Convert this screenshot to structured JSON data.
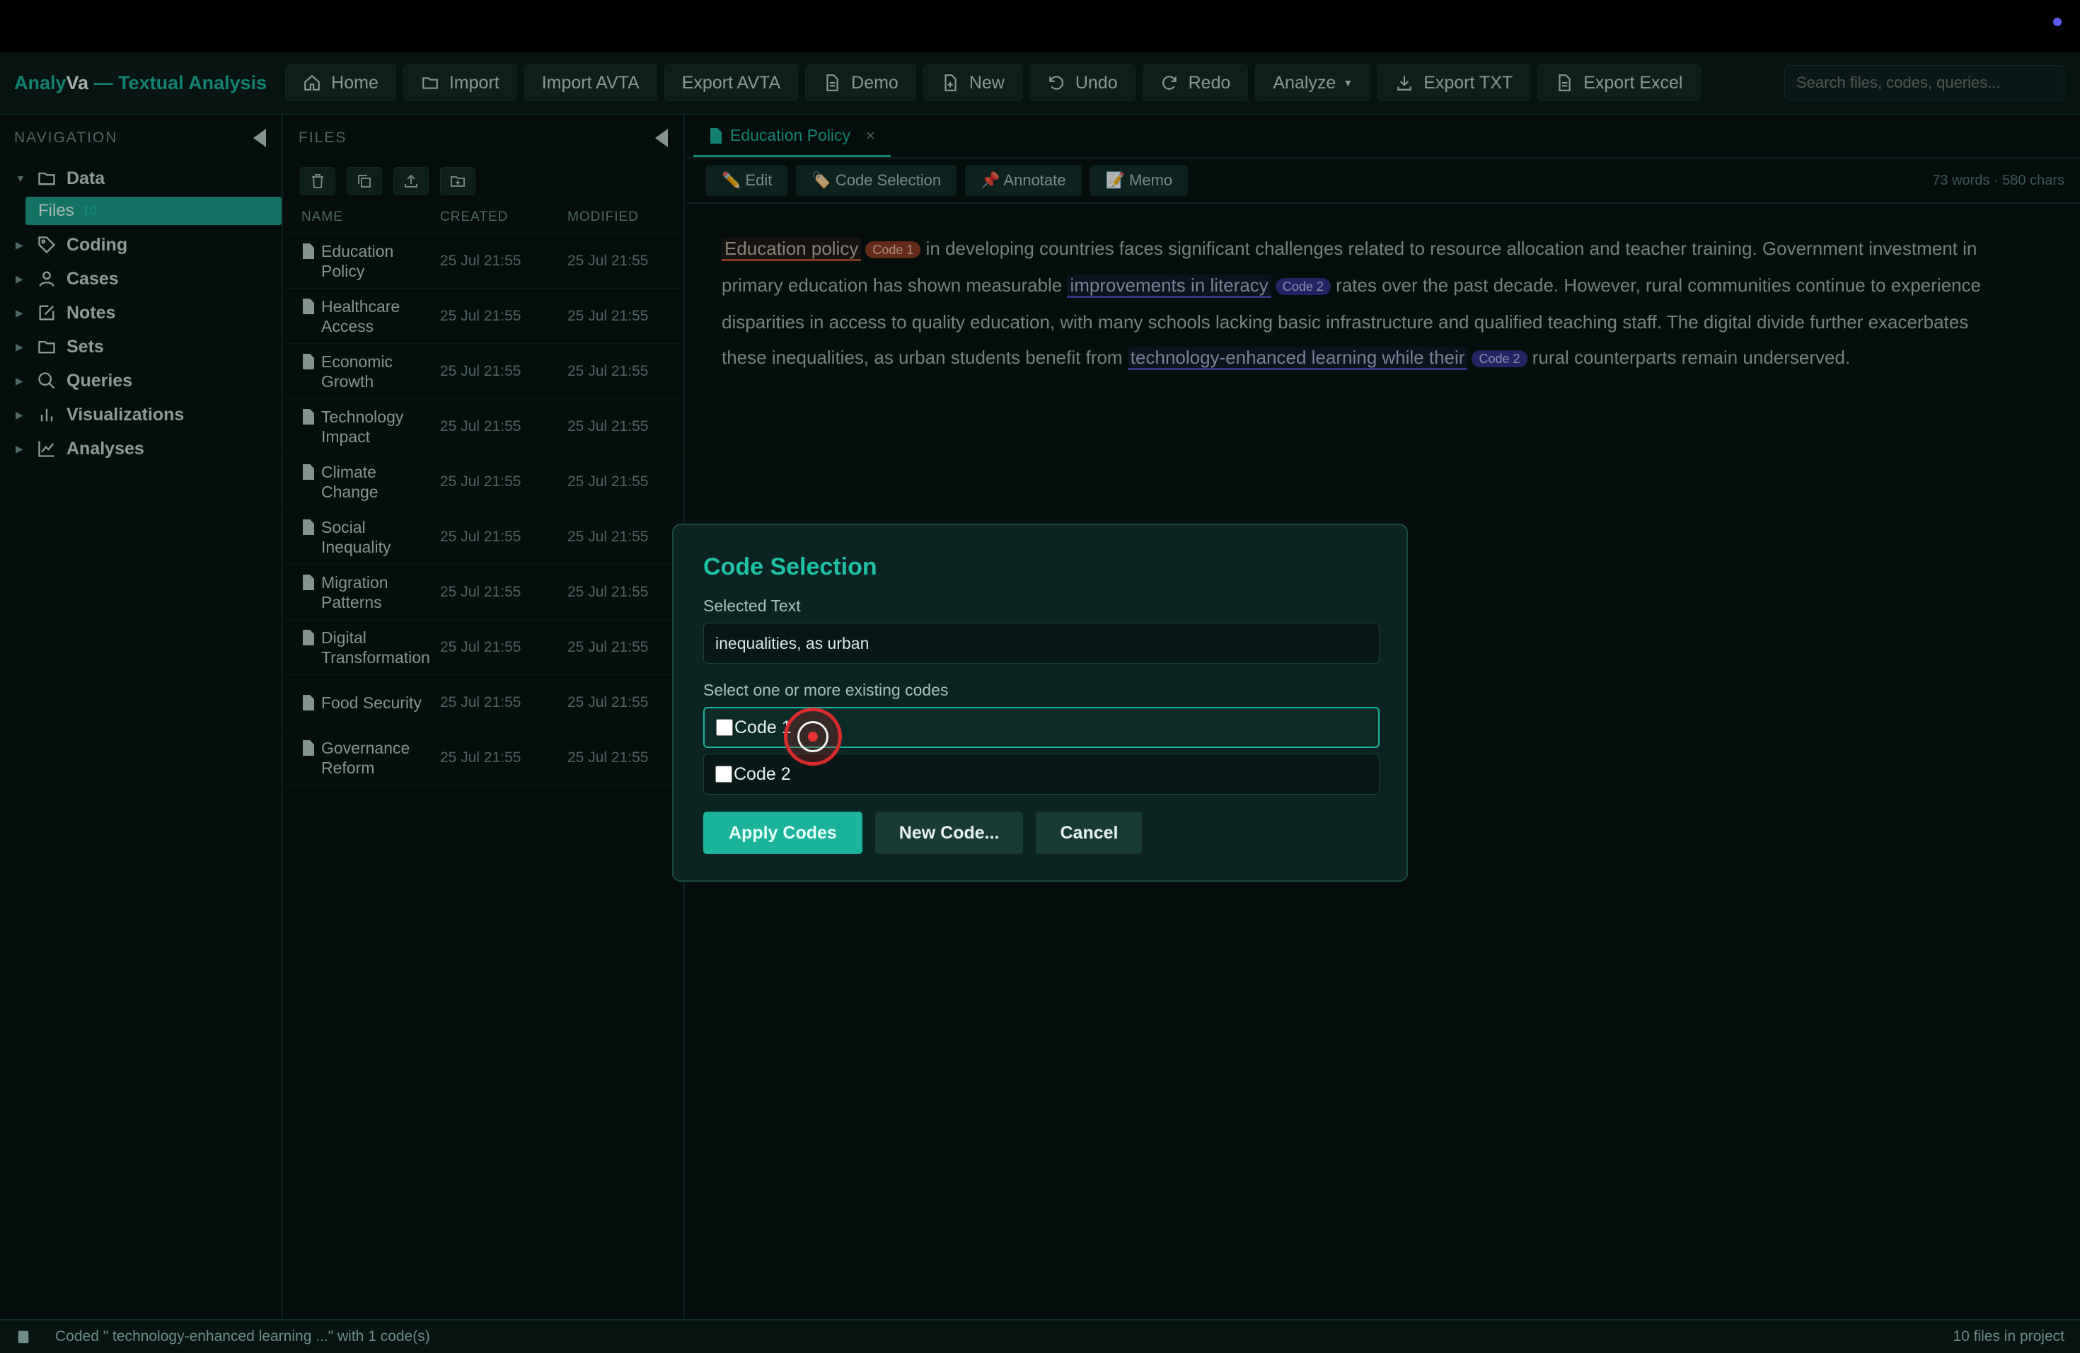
{
  "app": {
    "brand_prefix": "Analy",
    "brand_bold": "Va",
    "brand_suffix": " — Textual Analysis"
  },
  "toolbar": {
    "buttons": [
      {
        "label": "Home",
        "icon": "home-icon"
      },
      {
        "label": "Import",
        "icon": "folder-icon"
      },
      {
        "label": "Import AVTA",
        "icon": ""
      },
      {
        "label": "Export AVTA",
        "icon": ""
      },
      {
        "label": "Demo",
        "icon": "document-icon"
      },
      {
        "label": "New",
        "icon": "new-file-icon"
      },
      {
        "label": "Undo",
        "icon": "undo-icon"
      },
      {
        "label": "Redo",
        "icon": "redo-icon"
      },
      {
        "label": "Analyze",
        "icon": ""
      },
      {
        "label": "Export TXT",
        "icon": "download-icon"
      },
      {
        "label": "Export Excel",
        "icon": "document-icon"
      }
    ],
    "search_placeholder": "Search files, codes, queries..."
  },
  "nav": {
    "header": "NAVIGATION",
    "items": [
      {
        "label": "Data",
        "icon": "folder-icon",
        "expanded": true
      },
      {
        "label": "Coding",
        "icon": "tag-icon"
      },
      {
        "label": "Cases",
        "icon": "user-icon"
      },
      {
        "label": "Notes",
        "icon": "note-edit-icon"
      },
      {
        "label": "Sets",
        "icon": "folder-icon"
      },
      {
        "label": "Queries",
        "icon": "search-icon"
      },
      {
        "label": "Visualizations",
        "icon": "bar-chart-icon"
      },
      {
        "label": "Analyses",
        "icon": "line-chart-icon"
      }
    ],
    "data_sub": {
      "label": "Files",
      "count": "10"
    }
  },
  "files": {
    "header": "FILES",
    "columns": [
      "NAME",
      "CREATED",
      "MODIFIED"
    ],
    "rows": [
      {
        "name": "Education Policy",
        "created": "25 Jul 21:55",
        "modified": "25 Jul 21:55"
      },
      {
        "name": "Healthcare Access",
        "created": "25 Jul 21:55",
        "modified": "25 Jul 21:55"
      },
      {
        "name": "Economic Growth",
        "created": "25 Jul 21:55",
        "modified": "25 Jul 21:55"
      },
      {
        "name": "Technology Impact",
        "created": "25 Jul 21:55",
        "modified": "25 Jul 21:55"
      },
      {
        "name": "Climate Change",
        "created": "25 Jul 21:55",
        "modified": "25 Jul 21:55"
      },
      {
        "name": "Social Inequality",
        "created": "25 Jul 21:55",
        "modified": "25 Jul 21:55"
      },
      {
        "name": "Migration Patterns",
        "created": "25 Jul 21:55",
        "modified": "25 Jul 21:55"
      },
      {
        "name": "Digital Transformation",
        "created": "25 Jul 21:55",
        "modified": "25 Jul 21:55"
      },
      {
        "name": "Food Security",
        "created": "25 Jul 21:55",
        "modified": "25 Jul 21:55"
      },
      {
        "name": "Governance Reform",
        "created": "25 Jul 21:55",
        "modified": "25 Jul 21:55"
      }
    ]
  },
  "doc": {
    "tab_label": "Education Policy",
    "tools": [
      "✏️ Edit",
      "🏷️ Code Selection",
      "📌 Annotate",
      "📝 Memo"
    ],
    "stats": "73 words · 580 chars",
    "text": {
      "hl1": "Education policy",
      "badge1": "Code 1",
      "seg1": " in developing countries faces significant challenges related to resource allocation and teacher training. Government investment in primary education has shown measurable ",
      "hl2": "improvements in literacy",
      "badge2": "Code 2",
      "seg2": " rates over the past decade. However, rural communities continue to experience disparities in access to quality education, with many schools lacking basic infrastructure and qualified teaching staff. The digital divide further exacerbates these inequalities, as urban students benefit from ",
      "hl3": " technology-enhanced learning while their",
      "badge3": "Code 2",
      "seg3": " rural counterparts remain underserved."
    }
  },
  "modal": {
    "title": "Code Selection",
    "selected_label": "Selected Text",
    "selected_value": "inequalities, as urban",
    "codes_label": "Select one or more existing codes",
    "codes": [
      "Code 1",
      "Code 2"
    ],
    "apply": "Apply Codes",
    "new_code": "New Code...",
    "cancel": "Cancel"
  },
  "status": {
    "message": "Coded \" technology-enhanced learning ...\" with 1 code(s)",
    "right": "10 files in project"
  },
  "colors": {
    "accent": "#1bb39b",
    "code1": "#b4522e",
    "code2": "#4747b8"
  }
}
